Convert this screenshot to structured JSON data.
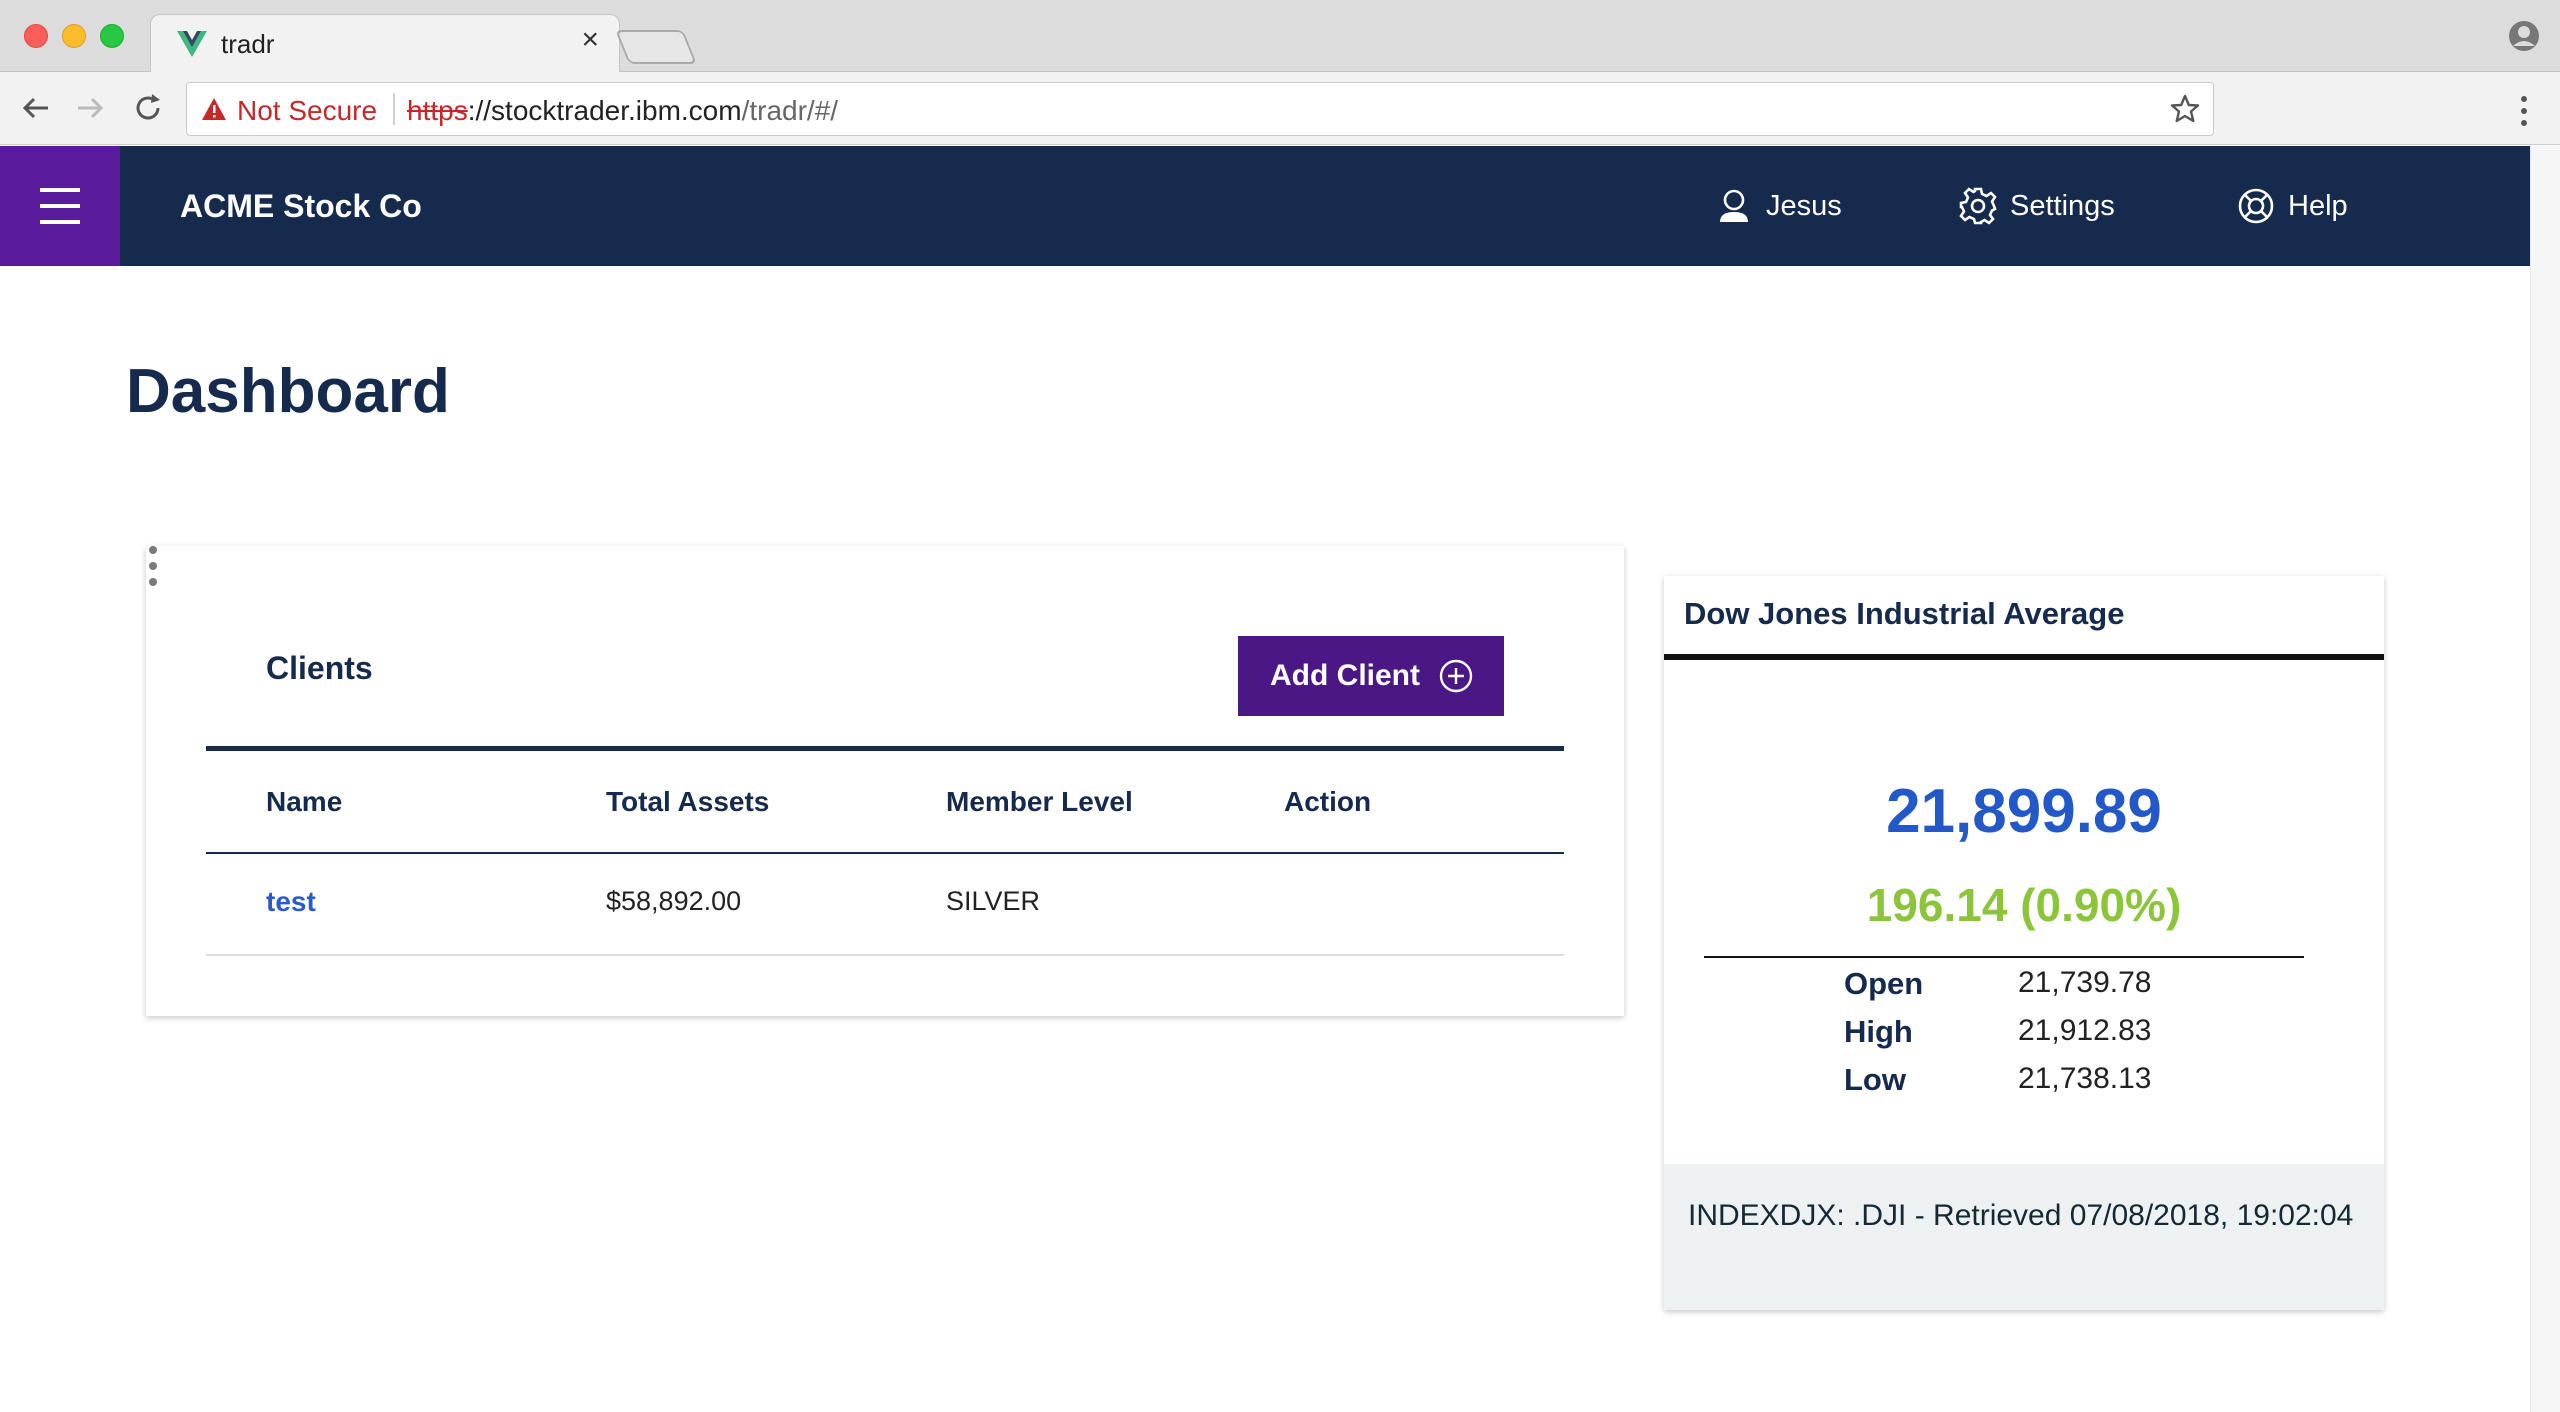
{
  "browser": {
    "tab_title": "tradr",
    "tab_close": "×",
    "not_secure": "Not Secure",
    "url_scheme": "https",
    "url_sep": "://",
    "url_host": "stocktrader.ibm.com",
    "url_path": "/tradr/#/"
  },
  "header": {
    "brand": "ACME Stock Co",
    "user": "Jesus",
    "settings": "Settings",
    "help": "Help"
  },
  "page": {
    "title": "Dashboard"
  },
  "clients": {
    "title": "Clients",
    "add_button": "Add Client",
    "columns": [
      "Name",
      "Total Assets",
      "Member Level",
      "Action"
    ],
    "rows": [
      {
        "name": "test",
        "total_assets": "$58,892.00",
        "member_level": "SILVER"
      }
    ]
  },
  "dji": {
    "title": "Dow Jones Industrial Average",
    "value": "21,899.89",
    "change": "196.14 (0.90%)",
    "stats": [
      {
        "label": "Open",
        "value": "21,739.78"
      },
      {
        "label": "High",
        "value": "21,912.83"
      },
      {
        "label": "Low",
        "value": "21,738.13"
      }
    ],
    "footer": "INDEXDJX: .DJI - Retrieved 07/08/2018, 19:02:04"
  },
  "colors": {
    "header_bg": "#152a4d",
    "accent_purple": "#4a1785",
    "value_blue": "#2258c7",
    "change_green": "#8cc43c"
  }
}
